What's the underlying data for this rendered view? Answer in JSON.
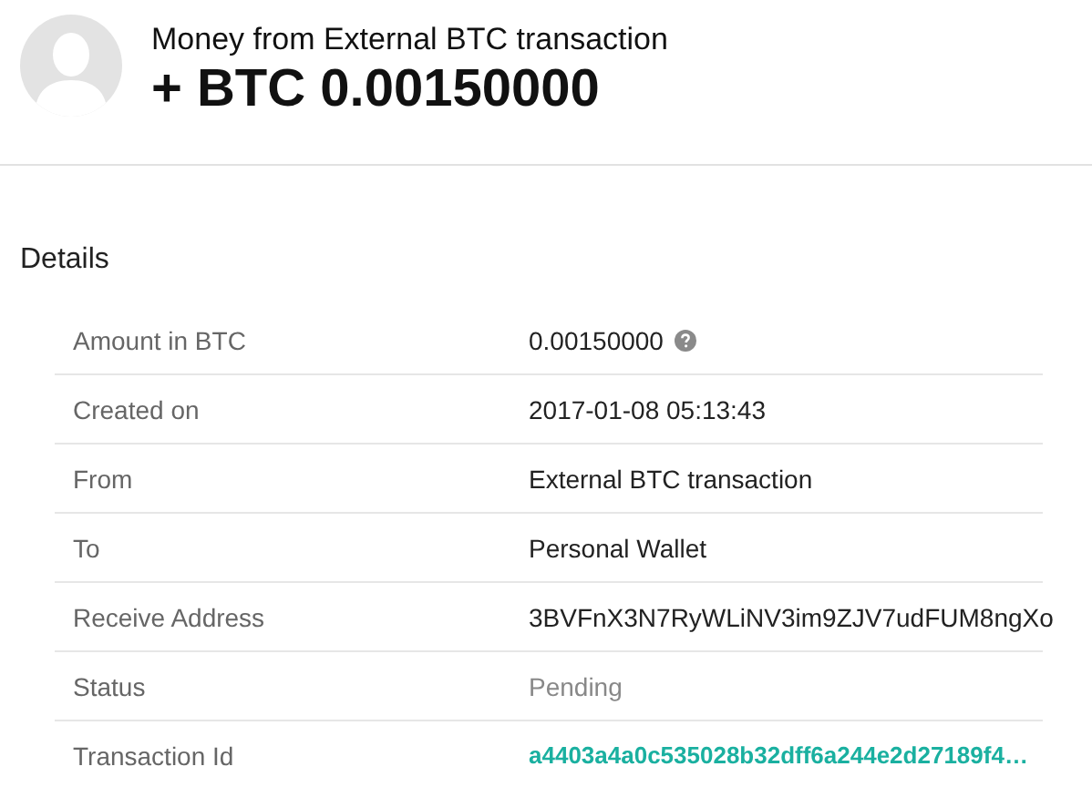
{
  "header": {
    "title": "Money from External BTC transaction",
    "amount": "+ BTC 0.00150000"
  },
  "details": {
    "heading": "Details",
    "rows": [
      {
        "label": "Amount in BTC",
        "value": "0.00150000",
        "kind": "help"
      },
      {
        "label": "Created on",
        "value": "2017-01-08 05:13:43",
        "kind": "plain"
      },
      {
        "label": "From",
        "value": "External BTC transaction",
        "kind": "plain"
      },
      {
        "label": "To",
        "value": "Personal Wallet",
        "kind": "plain"
      },
      {
        "label": "Receive Address",
        "value": "3BVFnX3N7RyWLiNV3im9ZJV7udFUM8ngXo",
        "kind": "plain"
      },
      {
        "label": "Status",
        "value": "Pending",
        "kind": "muted"
      },
      {
        "label": "Transaction Id",
        "value": "a4403a4a0c535028b32dff6a244e2d27189f4…",
        "kind": "link"
      }
    ]
  }
}
